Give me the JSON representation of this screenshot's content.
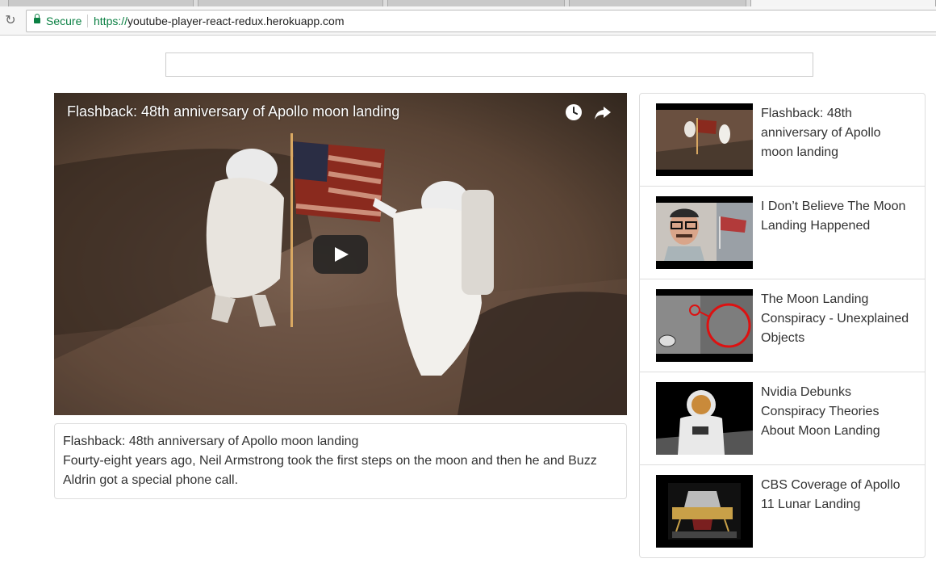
{
  "browser": {
    "secure_label": "Secure",
    "url_scheme": "https://",
    "url_host": "youtube-player-react-redux.herokuapp.com"
  },
  "search": {
    "value": "",
    "placeholder": ""
  },
  "player": {
    "title": "Flashback: 48th anniversary of Apollo moon landing",
    "icons": [
      "clock-icon",
      "share-icon",
      "play-icon"
    ]
  },
  "details": {
    "title": "Flashback: 48th anniversary of Apollo moon landing",
    "description": "Fourty-eight years ago, Neil Armstrong took the first steps on the moon and then he and Buzz Aldrin got a special phone call."
  },
  "videos": [
    {
      "title": "Flashback: 48th anniversary of Apollo moon landing"
    },
    {
      "title": "I Don’t Believe The Moon Landing Happened"
    },
    {
      "title": "The Moon Landing Conspiracy - Unexplained Objects"
    },
    {
      "title": "Nvidia Debunks Conspiracy Theories About Moon Landing"
    },
    {
      "title": "CBS Coverage of Apollo 11 Lunar Landing"
    }
  ],
  "colors": {
    "secure_green": "#0b8043",
    "border": "#dddddd",
    "text": "#333333"
  }
}
